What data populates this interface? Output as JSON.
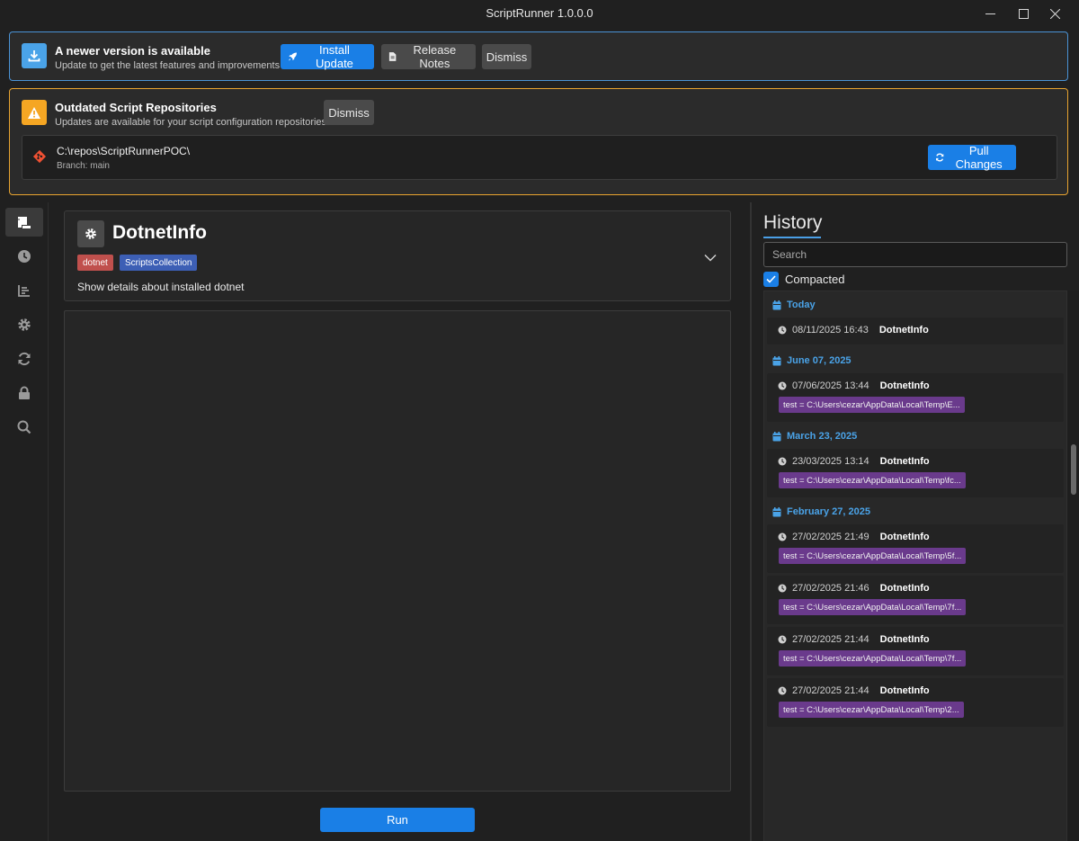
{
  "window": {
    "title": "ScriptRunner 1.0.0.0"
  },
  "update_banner": {
    "title": "A newer version is available",
    "subtitle": "Update to get the latest features and improvements",
    "install_label": "Install Update",
    "notes_label": "Release Notes",
    "dismiss_label": "Dismiss",
    "accent": "#4a93d6"
  },
  "outdated_banner": {
    "title": "Outdated Script Repositories",
    "subtitle": "Updates are available for your script configuration repositories",
    "dismiss_label": "Dismiss",
    "accent": "#e8a430",
    "repo": {
      "path": "C:\\repos\\ScriptRunnerPOC\\",
      "branch": "Branch: main",
      "pull_label": "Pull Changes"
    }
  },
  "sidebar": {
    "items": [
      {
        "icon": "scripts-icon",
        "active": true
      },
      {
        "icon": "clock-icon",
        "active": false
      },
      {
        "icon": "list-icon",
        "active": false
      },
      {
        "icon": "gear-icon",
        "active": false
      },
      {
        "icon": "sync-icon",
        "active": false
      },
      {
        "icon": "lock-icon",
        "active": false
      },
      {
        "icon": "search-icon",
        "active": false
      }
    ]
  },
  "script": {
    "name": "DotnetInfo",
    "tags": [
      {
        "label": "dotnet",
        "color": "#c0504d"
      },
      {
        "label": "ScriptsCollection",
        "color": "#3d5fb5"
      }
    ],
    "description": "Show details about installed dotnet",
    "run_label": "Run"
  },
  "history": {
    "title": "History",
    "search_placeholder": "Search",
    "compacted_label": "Compacted",
    "compacted_checked": true,
    "groups": [
      {
        "label": "Today",
        "entries": [
          {
            "date": "08/11/2025 16:43",
            "name": "DotnetInfo",
            "param": ""
          }
        ]
      },
      {
        "label": "June 07, 2025",
        "entries": [
          {
            "date": "07/06/2025 13:44",
            "name": "DotnetInfo",
            "param": "test = C:\\Users\\cezar\\AppData\\Local\\Temp\\E..."
          }
        ]
      },
      {
        "label": "March 23, 2025",
        "entries": [
          {
            "date": "23/03/2025 13:14",
            "name": "DotnetInfo",
            "param": "test = C:\\Users\\cezar\\AppData\\Local\\Temp\\fc..."
          }
        ]
      },
      {
        "label": "February 27, 2025",
        "entries": [
          {
            "date": "27/02/2025 21:49",
            "name": "DotnetInfo",
            "param": "test = C:\\Users\\cezar\\AppData\\Local\\Temp\\5f..."
          },
          {
            "date": "27/02/2025 21:46",
            "name": "DotnetInfo",
            "param": "test = C:\\Users\\cezar\\AppData\\Local\\Temp\\7f..."
          },
          {
            "date": "27/02/2025 21:44",
            "name": "DotnetInfo",
            "param": "test = C:\\Users\\cezar\\AppData\\Local\\Temp\\7f..."
          },
          {
            "date": "27/02/2025 21:44",
            "name": "DotnetInfo",
            "param": "test = C:\\Users\\cezar\\AppData\\Local\\Temp\\2..."
          }
        ]
      }
    ]
  }
}
